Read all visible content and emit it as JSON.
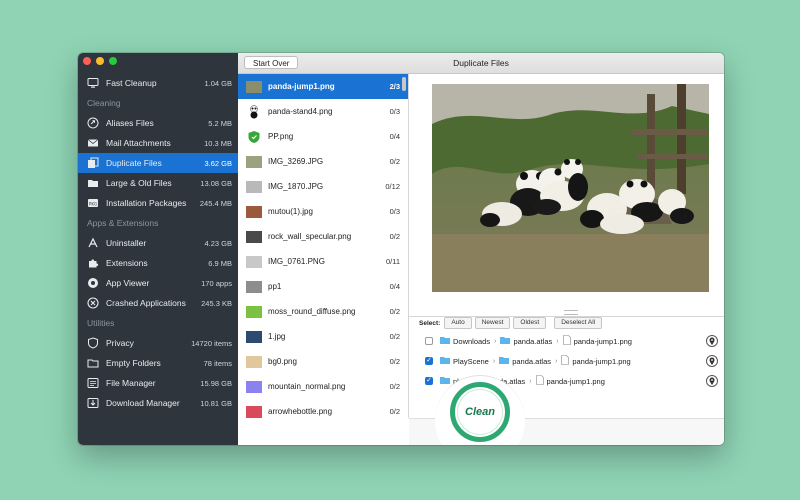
{
  "window": {
    "title": "Duplicate Files",
    "start_over": "Start Over"
  },
  "sidebar": {
    "top": [
      {
        "label": "Fast Cleanup",
        "size": "1.04 GB",
        "icon": "monitor-icon"
      }
    ],
    "sections": [
      {
        "title": "Cleaning",
        "items": [
          {
            "label": "Aliases Files",
            "size": "5.2 MB",
            "icon": "aliases-icon"
          },
          {
            "label": "Mail Attachments",
            "size": "10.3 MB",
            "icon": "mail-icon"
          },
          {
            "label": "Duplicate Files",
            "size": "3.62 GB",
            "icon": "duplicate-icon",
            "active": true
          },
          {
            "label": "Large & Old Files",
            "size": "13.08 GB",
            "icon": "folder-icon"
          },
          {
            "label": "Installation Packages",
            "size": "245.4 MB",
            "icon": "package-icon"
          }
        ]
      },
      {
        "title": "Apps & Extensions",
        "items": [
          {
            "label": "Uninstaller",
            "size": "4.23 GB",
            "icon": "apps-icon"
          },
          {
            "label": "Extensions",
            "size": "6.9 MB",
            "icon": "puzzle-icon"
          },
          {
            "label": "App Viewer",
            "size": "170 apps",
            "icon": "eye-icon"
          },
          {
            "label": "Crashed Applications",
            "size": "245.3 KB",
            "icon": "crash-icon"
          }
        ]
      },
      {
        "title": "Utilities",
        "items": [
          {
            "label": "Privacy",
            "size": "14720 items",
            "icon": "shield-icon"
          },
          {
            "label": "Empty Folders",
            "size": "78 items",
            "icon": "empty-folder-icon"
          },
          {
            "label": "File Manager",
            "size": "15.98 GB",
            "icon": "file-manager-icon"
          },
          {
            "label": "Download Manager",
            "size": "10.81 GB",
            "icon": "download-icon"
          }
        ]
      }
    ]
  },
  "files": [
    {
      "name": "panda-jump1.png",
      "count": "2/3",
      "selected": true,
      "thumb": "#8a8f6a"
    },
    {
      "name": "panda-stand4.png",
      "count": "0/3",
      "thumb": "panda"
    },
    {
      "name": "PP.png",
      "count": "0/4",
      "thumb": "shield"
    },
    {
      "name": "IMG_3269.JPG",
      "count": "0/2",
      "thumb": "#9aa27f"
    },
    {
      "name": "IMG_1870.JPG",
      "count": "0/12",
      "thumb": "#b9b9b9"
    },
    {
      "name": "mutou(1).jpg",
      "count": "0/3",
      "thumb": "#9b5a3a"
    },
    {
      "name": "rock_wall_specular.png",
      "count": "0/2",
      "thumb": "#4a4a4a"
    },
    {
      "name": "IMG_0761.PNG",
      "count": "0/11",
      "thumb": "#c8c8c8"
    },
    {
      "name": "pp1",
      "count": "0/4",
      "thumb": "#8d8d8d"
    },
    {
      "name": "moss_round_diffuse.png",
      "count": "0/2",
      "thumb": "#7cc242"
    },
    {
      "name": "1.jpg",
      "count": "0/2",
      "thumb": "#2d4b6e"
    },
    {
      "name": "bg0.png",
      "count": "0/2",
      "thumb": "#e0c89a"
    },
    {
      "name": "mountain_normal.png",
      "count": "0/2",
      "thumb": "#8b82f0"
    },
    {
      "name": "arrowhebottle.png",
      "count": "0/2",
      "thumb": "#d94a5a"
    }
  ],
  "select_bar": {
    "label": "Select:",
    "auto": "Auto",
    "newest": "Newest",
    "oldest": "Oldest",
    "deselect_all": "Deselect All"
  },
  "paths": [
    {
      "checked": false,
      "folder": "Downloads",
      "sub": "panda.atlas",
      "file": "panda-jump1.png"
    },
    {
      "checked": true,
      "folder": "PlayScene",
      "sub": "panda.atlas",
      "file": "panda-jump1.png"
    },
    {
      "checked": true,
      "folder": "pla",
      "sub": "panda.atlas",
      "file": "panda-jump1.png"
    }
  ],
  "clean_label": "Clean",
  "colors": {
    "accent": "#1a73d2",
    "sidebar_bg": "#2e353d",
    "clean_ring": "#2ea872",
    "desktop": "#8fd3b4"
  }
}
